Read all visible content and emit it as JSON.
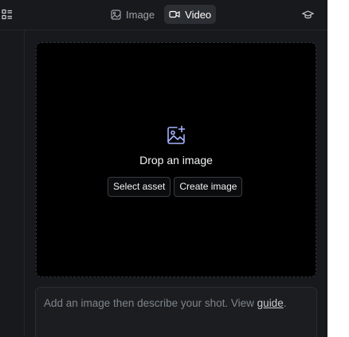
{
  "header": {
    "tabs": [
      {
        "label": "Image",
        "icon": "image-icon",
        "active": false
      },
      {
        "label": "Video",
        "icon": "video-icon",
        "active": true
      }
    ],
    "left_icon": "grid-list-icon",
    "right_icon": "graduation-cap-icon"
  },
  "dropzone": {
    "icon": "image-add-icon",
    "title": "Drop an image",
    "buttons": {
      "select_asset": "Select asset",
      "create_image": "Create image"
    }
  },
  "prompt": {
    "placeholder_text": "Add an image then describe your shot. View ",
    "link_text": "guide",
    "trailing": "."
  },
  "colors": {
    "background": "#17191c",
    "dropzone_bg": "#000000",
    "accent_icon": "#a8b2ff"
  }
}
